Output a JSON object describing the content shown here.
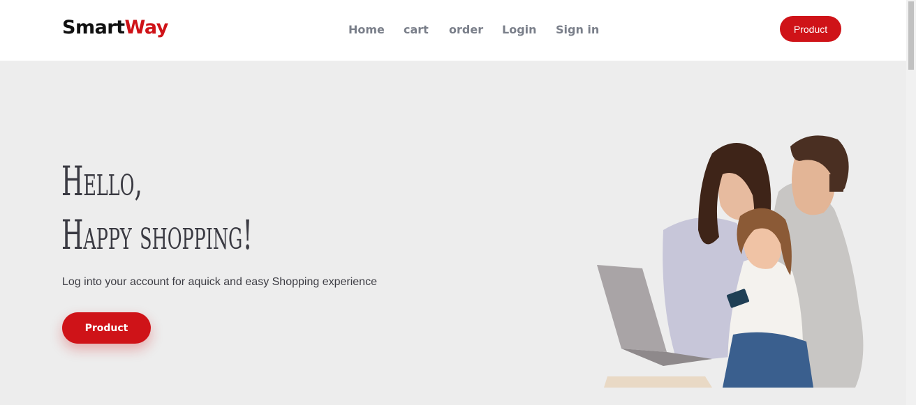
{
  "brand": {
    "part1": "Smart",
    "part2": "Way"
  },
  "nav": {
    "items": [
      "Home",
      "cart",
      "order",
      "Login",
      "Sign in"
    ]
  },
  "header_button": "Product",
  "hero": {
    "title_line1": "Hello,",
    "title_line2": "Happy shopping!",
    "subtitle": "Log into your account for aquick and easy Shopping experience",
    "button": "Product",
    "image_icon": "family-shopping-photo"
  },
  "colors": {
    "accent": "#cf1318",
    "background": "#ededed",
    "header_bg": "#ffffff",
    "nav_text": "#7a7f8a"
  }
}
